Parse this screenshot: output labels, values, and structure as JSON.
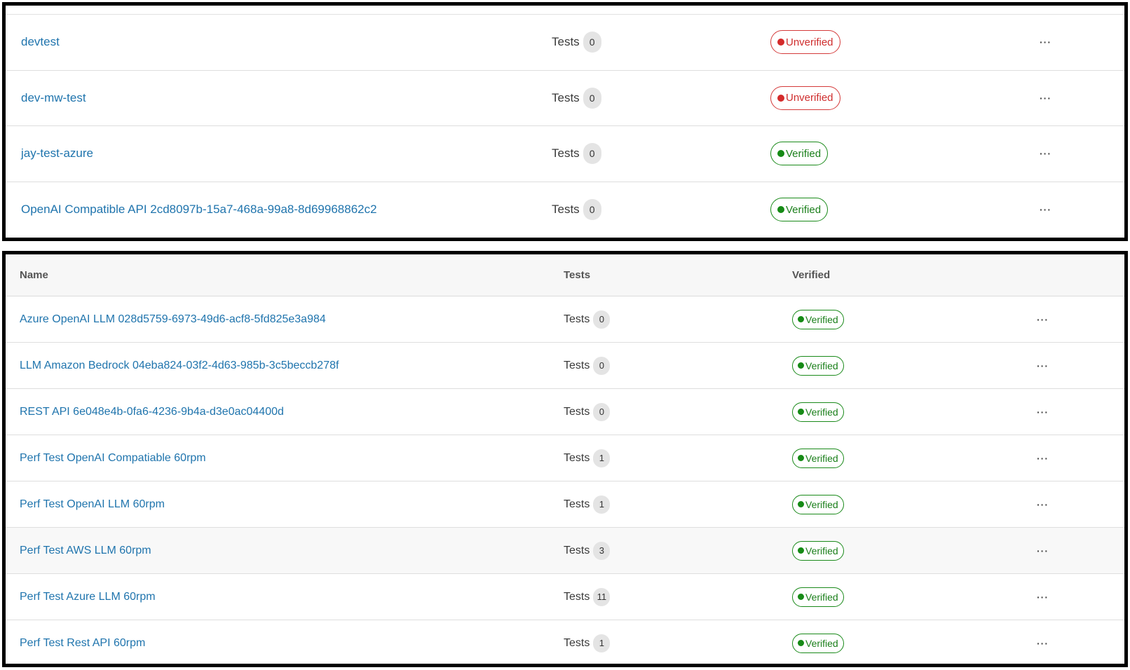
{
  "top_table": {
    "rows": [
      {
        "name": "devtest",
        "tests_label": "Tests",
        "count": "0",
        "status": "Unverified"
      },
      {
        "name": "dev-mw-test",
        "tests_label": "Tests",
        "count": "0",
        "status": "Unverified"
      },
      {
        "name": "jay-test-azure",
        "tests_label": "Tests",
        "count": "0",
        "status": "Verified"
      },
      {
        "name": "OpenAI Compatible API 2cd8097b-15a7-468a-99a8-8d69968862c2",
        "tests_label": "Tests",
        "count": "0",
        "status": "Verified"
      }
    ]
  },
  "bottom_table": {
    "headers": {
      "name": "Name",
      "tests": "Tests",
      "verified": "Verified"
    },
    "rows": [
      {
        "name": "Azure OpenAI LLM 028d5759-6973-49d6-acf8-5fd825e3a984",
        "tests_label": "Tests",
        "count": "0",
        "status": "Verified"
      },
      {
        "name": "LLM Amazon Bedrock 04eba824-03f2-4d63-985b-3c5beccb278f",
        "tests_label": "Tests",
        "count": "0",
        "status": "Verified"
      },
      {
        "name": "REST API 6e048e4b-0fa6-4236-9b4a-d3e0ac04400d",
        "tests_label": "Tests",
        "count": "0",
        "status": "Verified"
      },
      {
        "name": "Perf Test OpenAI Compatiable 60rpm",
        "tests_label": "Tests",
        "count": "1",
        "status": "Verified"
      },
      {
        "name": "Perf Test OpenAI LLM 60rpm",
        "tests_label": "Tests",
        "count": "1",
        "status": "Verified"
      },
      {
        "name": "Perf Test AWS LLM 60rpm",
        "tests_label": "Tests",
        "count": "3",
        "status": "Verified"
      },
      {
        "name": "Perf Test Azure LLM 60rpm",
        "tests_label": "Tests",
        "count": "11",
        "status": "Verified"
      },
      {
        "name": "Perf Test Rest API 60rpm",
        "tests_label": "Tests",
        "count": "1",
        "status": "Verified"
      }
    ]
  },
  "more_label": "···",
  "icons": {
    "status_dot": "status-dot-icon",
    "more": "more-options-icon"
  },
  "colors": {
    "link": "#1f74ad",
    "verified": "#1a7f1a",
    "unverified": "#cf2e2e",
    "badge_bg": "#e4e4e4"
  }
}
